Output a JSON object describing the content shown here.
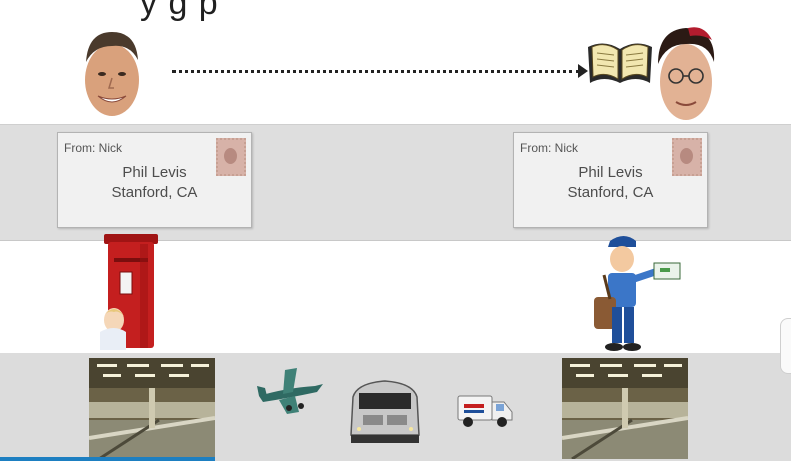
{
  "slide": {
    "title_fragment": "y  g    p"
  },
  "envelopes": [
    {
      "from": "From: Nick",
      "name": "Phil Levis",
      "city": "Stanford, CA"
    },
    {
      "from": "From: Nick",
      "name": "Phil Levis",
      "city": "Stanford, CA"
    }
  ],
  "icons": {
    "sender": "sender-portrait-icon",
    "recipient": "recipient-portrait-icon",
    "book": "open-book-icon",
    "postbox": "red-postbox-icon",
    "mail_carrier": "mail-carrier-icon",
    "sorting_facility": "sorting-facility-icon",
    "airplane": "airplane-icon",
    "train": "train-icon",
    "mail_truck": "mail-truck-icon"
  },
  "colors": {
    "band": "#dedede",
    "postbox_red": "#c41f1f",
    "accent_blue": "#1d7fc1"
  }
}
